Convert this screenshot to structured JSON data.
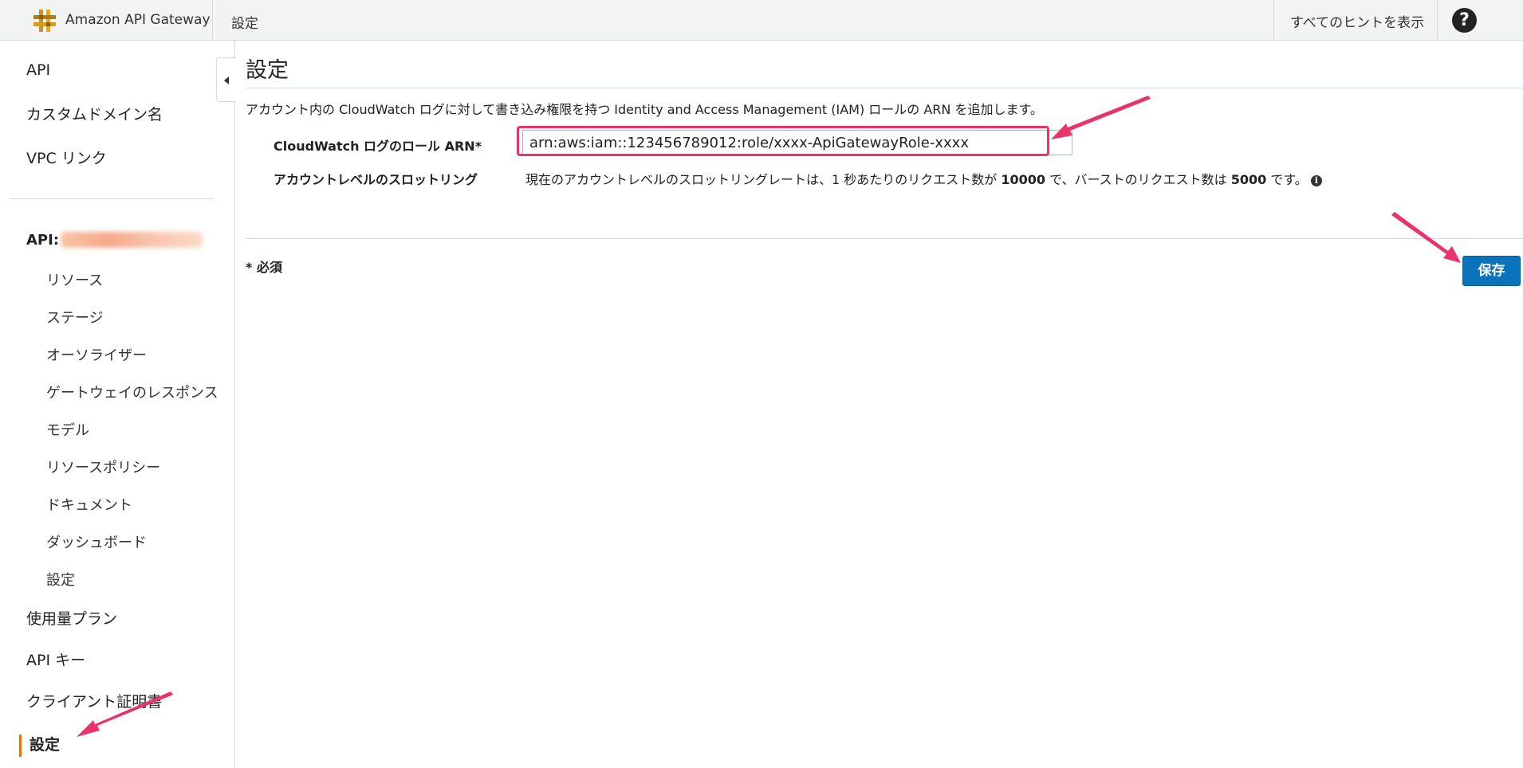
{
  "header": {
    "brand": "Amazon API Gateway",
    "breadcrumb": "設定",
    "show_hints": "すべてのヒントを表示",
    "help_label": "?"
  },
  "sidebar": {
    "top_items": [
      "API",
      "カスタムドメイン名",
      "VPC リンク"
    ],
    "api_label": "API:",
    "api_sub_items": [
      "リソース",
      "ステージ",
      "オーソライザー",
      "ゲートウェイのレスポンス",
      "モデル",
      "リソースポリシー",
      "ドキュメント",
      "ダッシュボード",
      "設定"
    ],
    "bottom_items": [
      "使用量プラン",
      "API キー",
      "クライアント証明書"
    ],
    "active_item": "設定"
  },
  "main": {
    "title": "設定",
    "description": "アカウント内の CloudWatch ログに対して書き込み権限を持つ Identity and Access Management (IAM) ロールの ARN を追加します。",
    "arn_label": "CloudWatch ログのロール ARN*",
    "arn_value": "arn:aws:iam::123456789012:role/xxxx-ApiGatewayRole-xxxx",
    "throttle_label": "アカウントレベルのスロットリング",
    "throttle_text_1": "現在のアカウントレベルのスロットリングレートは、1 秒あたりのリクエスト数が ",
    "throttle_rate": "10000",
    "throttle_text_2": " で、バーストのリクエスト数は ",
    "throttle_burst": "5000",
    "throttle_text_3": " です。",
    "required_note": "* 必須",
    "save_label": "保存"
  },
  "colors": {
    "accent_orange": "#ec7211",
    "save_blue": "#0a73bb",
    "annotation_pink": "#e8336b"
  }
}
